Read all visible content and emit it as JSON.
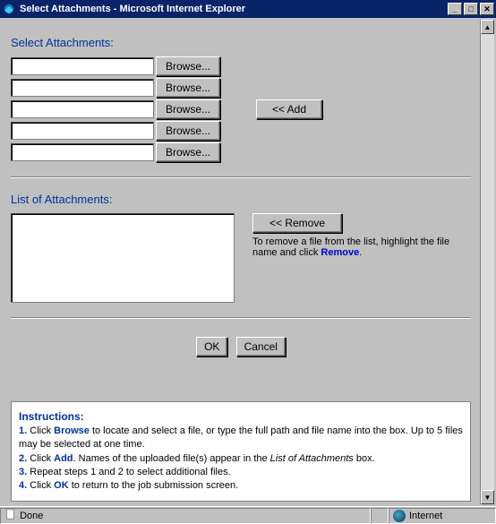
{
  "window": {
    "title": "Select Attachments - Microsoft Internet Explorer"
  },
  "section1": {
    "label": "Select Attachments:",
    "browse_label": "Browse...",
    "add_label": "<< Add"
  },
  "section2": {
    "label": "List of Attachments:",
    "remove_label": "<< Remove",
    "remove_text_1": "To remove a file from the list, highlight the file name and click",
    "remove_link": " Remove",
    "remove_text_2": "."
  },
  "buttons": {
    "ok": "OK",
    "cancel": "Cancel"
  },
  "instructions": {
    "title": "Instructions:",
    "l1a": "1.",
    "l1b": " Click ",
    "l1c": "Browse",
    "l1d": " to locate and select a file, or type the full path and file name into the box. Up to 5 files may be selected at one time.",
    "l2a": "2.",
    "l2b": " Click ",
    "l2c": "Add",
    "l2d": ". Names of the uploaded file(s) appear in the ",
    "l2e": "List of Attachments",
    "l2f": " box.",
    "l3a": "3.",
    "l3b": " Repeat steps 1 and 2 to select additional files.",
    "l4a": "4.",
    "l4b": " Click ",
    "l4c": "OK",
    "l4d": " to return to the job submission screen."
  },
  "status": {
    "done": "Done",
    "zone": "Internet"
  }
}
